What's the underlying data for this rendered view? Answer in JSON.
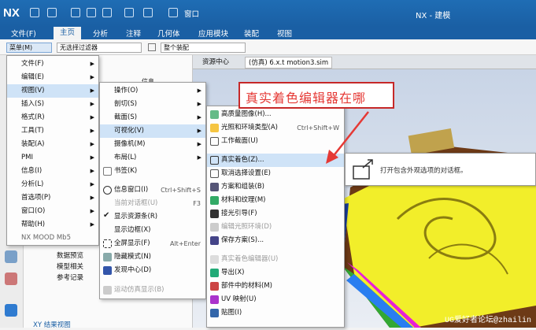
{
  "app": {
    "logo": "NX",
    "window_title": "NX - 建模"
  },
  "quickaccess": {
    "window_label": "窗口"
  },
  "menubar": {
    "items": [
      "文件(F)",
      "主页",
      "分析",
      "注释",
      "几何体",
      "应用模块",
      "装配",
      "视图"
    ]
  },
  "ribbon": {
    "menu_button": "菜单(M)",
    "filter_placeholder": "无选择过滤器",
    "scope_value": "整个装配"
  },
  "doc_tabs": [
    {
      "label": "资源中心"
    },
    {
      "label": "(仿真) 6.x.t motion3.sim"
    }
  ],
  "file_menu": {
    "items": [
      "文件(F)",
      "编辑(E)",
      "视图(V)",
      "插入(S)",
      "格式(R)",
      "工具(T)",
      "装配(A)",
      "PMI",
      "信息(I)",
      "分析(L)",
      "首选项(P)",
      "窗口(O)",
      "帮助(H)",
      "NX MOOD Mb5"
    ]
  },
  "view_menu": {
    "items": [
      "操作(O)",
      "剖切(S)",
      "截面(S)",
      "可视化(V)",
      "摄像机(M)",
      "布局(L)",
      "书签(K)",
      "信息窗口(I)",
      "当前对话框(U)",
      "显示资源条(R)",
      "显示边框(X)",
      "全屏显示(F)",
      "隐藏模式(N)",
      "发现中心(D)",
      "运动仿真显示(B)"
    ],
    "shortcuts": {
      "info": "Ctrl+Shift+S",
      "cur": "F3",
      "full": "Alt+Enter"
    }
  },
  "vis_menu": {
    "items": [
      "高质量图像(H)...",
      "光照和环境类型(A)",
      "工作截面(U)",
      "真实着色(Z)...",
      "取消选择设置(E)",
      "方案和组装(B)",
      "材料和纹理(M)",
      "接光引导(F)",
      "编辑光照环境(D)",
      "保存方案(S)...",
      "真实着色编辑器(U)",
      "导出(X)",
      "部件中的材料(M)",
      "UV 映射(U)",
      "贴图(I)"
    ],
    "shortcuts": {
      "light": "Ctrl+Shift+W"
    }
  },
  "callout": {
    "text": "真实着色编辑器在哪"
  },
  "tooltip": {
    "text": "打开包含外观选项的对话框。"
  },
  "left_panel": {
    "items": [
      "数据预览",
      "模型相关",
      "参考记录"
    ],
    "bottom_item": "XY 结果视图",
    "column_label": "信息"
  },
  "watermark": "UG爱好者论坛@zhailin",
  "colors": {
    "titlebar": "#1a5fa4",
    "highlight": "#cfe3f7",
    "callout": "#e53935",
    "model_yellow": "#f2ee2a"
  }
}
